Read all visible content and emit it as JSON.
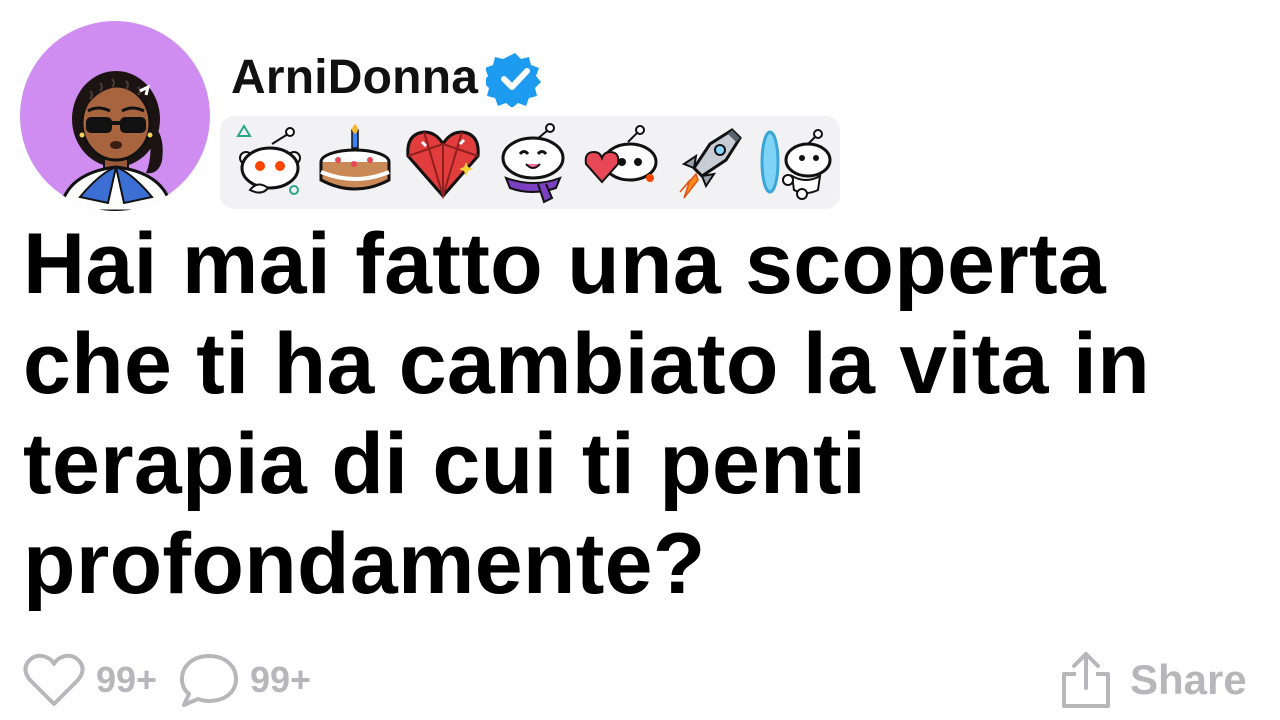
{
  "post": {
    "username": "ArniDonna",
    "title": "Hai mai fatto una scoperta che ti ha cambiato la vita in terapia di cui ti penti profondamente?",
    "title_lines": [
      "Hai mai fatto una scoperta",
      "che ti ha cambiato la vita in",
      "terapia di cui ti penti",
      "profondamente?"
    ]
  },
  "awards": [
    {
      "icon": "snoo-triangle-award-icon"
    },
    {
      "icon": "birthday-cake-award-icon"
    },
    {
      "icon": "crystal-heart-award-icon"
    },
    {
      "icon": "snoo-scarf-award-icon"
    },
    {
      "icon": "snoo-heart-award-icon"
    },
    {
      "icon": "rocket-award-icon"
    },
    {
      "icon": "snoo-portal-award-icon"
    }
  ],
  "footer": {
    "likes": "99+",
    "comments": "99+",
    "share_label": "Share"
  },
  "colors": {
    "avatar_bg": "#cf8df2",
    "verified": "#1d9bf0",
    "muted": "#b7b7bb",
    "awards_bg": "#f2f2f4"
  }
}
